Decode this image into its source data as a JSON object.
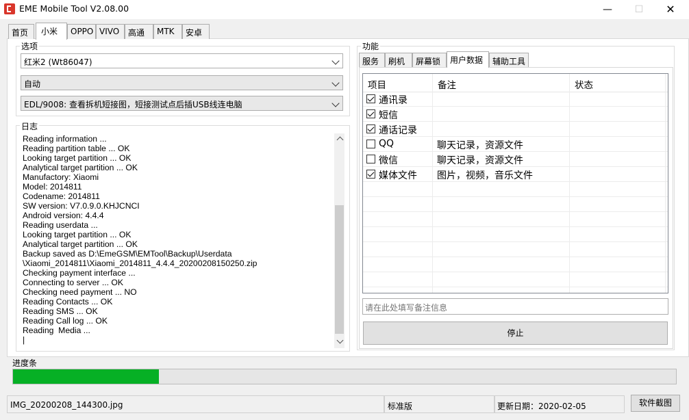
{
  "window": {
    "title": "EME Mobile Tool V2.08.00",
    "controls": {
      "minimize": "—",
      "maximize": "☐",
      "close": "✕"
    }
  },
  "main_tabs": [
    {
      "label": "首页",
      "active": false
    },
    {
      "label": "小米",
      "active": true
    },
    {
      "label": "OPPO",
      "active": false
    },
    {
      "label": "VIVO",
      "active": false
    },
    {
      "label": "高通",
      "active": false
    },
    {
      "label": "MTK",
      "active": false
    },
    {
      "label": "安卓",
      "active": false
    }
  ],
  "options": {
    "label": "选项",
    "device": "红米2 (Wt86047)",
    "mode": "自动",
    "connection": "EDL/9008: 查看拆机短接图，短接测试点后插USB线连电脑"
  },
  "log": {
    "label": "日志",
    "lines": [
      "Reading information ...",
      "Reading partition table ... OK",
      "Looking target partition ... OK",
      "Analytical target partition ... OK",
      "Manufactory: Xiaomi",
      "Model: 2014811",
      "Codename: 2014811",
      "SW version: V7.0.9.0.KHJCNCI",
      "Android version: 4.4.4",
      "Reading userdata ...",
      "Looking target partition ... OK",
      "Analytical target partition ... OK",
      "Backup saved as D:\\EmeGSM\\EMTool\\Backup\\Userdata",
      "\\Xiaomi_2014811\\Xiaomi_2014811_4.4.4_20200208150250.zip",
      "Checking payment interface ...",
      "Connecting to server ... OK",
      "Checking need payment ... NO",
      "Reading Contacts ... OK",
      "Reading SMS ... OK",
      "Reading Call log ... OK",
      "Reading  Media ...",
      "|"
    ]
  },
  "function": {
    "label": "功能",
    "tabs": [
      {
        "label": "服务",
        "active": false
      },
      {
        "label": "刷机",
        "active": false
      },
      {
        "label": "屏幕锁",
        "active": false
      },
      {
        "label": "用户数据",
        "active": true
      },
      {
        "label": "辅助工具",
        "active": false
      }
    ],
    "columns": [
      "项目",
      "备注",
      "状态"
    ],
    "rows": [
      {
        "item": "通讯录",
        "note": "",
        "status": "",
        "checked": true
      },
      {
        "item": "短信",
        "note": "",
        "status": "",
        "checked": true
      },
      {
        "item": "通话记录",
        "note": "",
        "status": "",
        "checked": true
      },
      {
        "item": "QQ",
        "note": "聊天记录，资源文件",
        "status": "",
        "checked": false
      },
      {
        "item": "微信",
        "note": "聊天记录，资源文件",
        "status": "",
        "checked": false
      },
      {
        "item": "媒体文件",
        "note": "图片，视频，音乐文件",
        "status": "",
        "checked": true
      }
    ],
    "note_placeholder": "请在此处填写备注信息",
    "stop_button": "停止"
  },
  "progress": {
    "label": "进度条",
    "value": 0.22,
    "color": "#06b025"
  },
  "status": {
    "file": "IMG_20200208_144300.jpg",
    "edition": "标准版",
    "update_date": "更新日期：2020-02-05",
    "screenshot_button": "软件截图"
  }
}
